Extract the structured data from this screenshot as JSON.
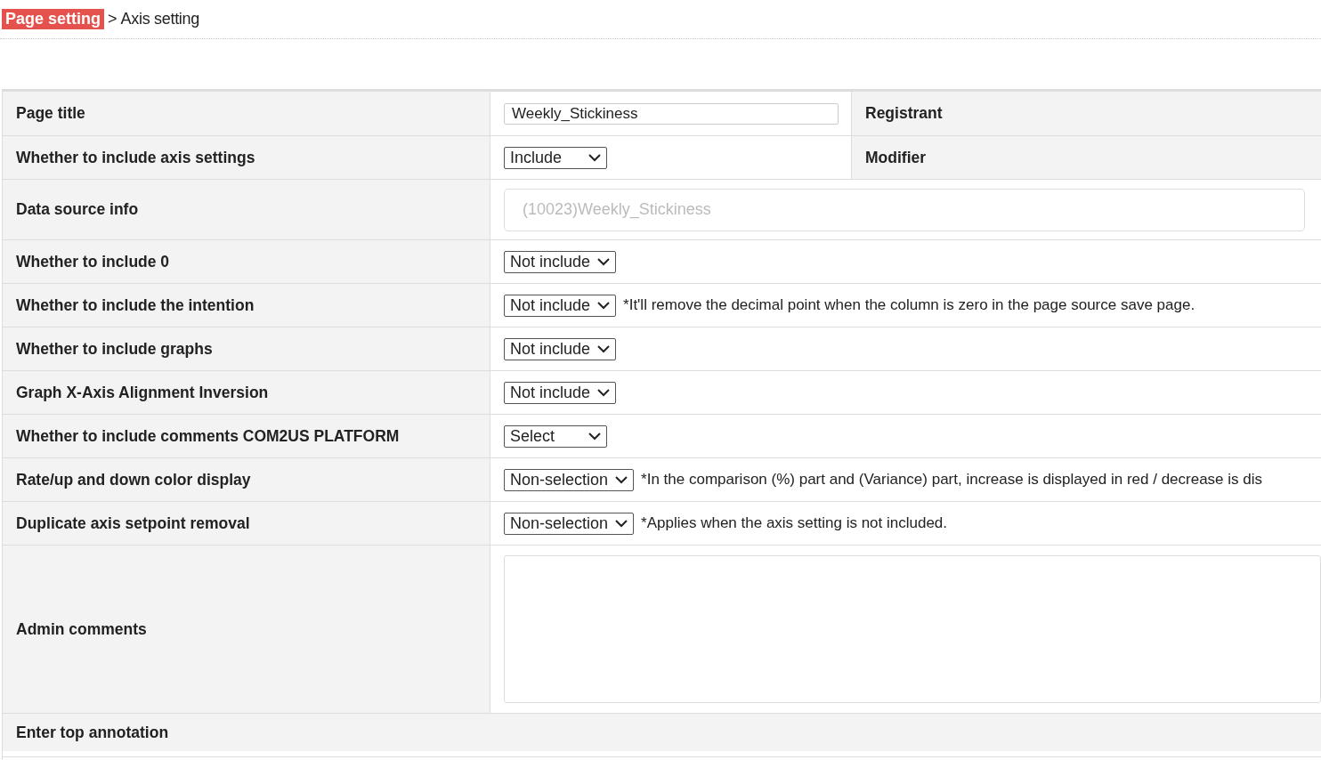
{
  "breadcrumb": {
    "parent": "Page setting",
    "separator": ">",
    "current": "Axis setting"
  },
  "rows": [
    {
      "label": "Page title",
      "kind": "text",
      "value": "Weekly_Stickiness",
      "side_label": "Registrant"
    },
    {
      "label": "Whether to include axis settings",
      "kind": "select",
      "value": "Include",
      "side_label": "Modifier"
    },
    {
      "label": "Data source info",
      "kind": "readonly",
      "value": "(10023)Weekly_Stickiness"
    },
    {
      "label": "Whether to include 0",
      "kind": "select",
      "value": "Not include"
    },
    {
      "label": "Whether to include the intention",
      "kind": "select",
      "value": "Not include",
      "note": "*It'll remove the decimal point when the column is zero in the page source save page."
    },
    {
      "label": "Whether to include graphs",
      "kind": "select",
      "value": "Not include"
    },
    {
      "label": "Graph X-Axis Alignment Inversion",
      "kind": "select",
      "value": "Not include"
    },
    {
      "label": "Whether to include comments COM2US PLATFORM",
      "kind": "select",
      "value": "Select"
    },
    {
      "label": "Rate/up and down color display",
      "kind": "select",
      "value": "Non-selection",
      "note": "*In the comparison (%) part and (Variance) part, increase is displayed in red / decrease is dis"
    },
    {
      "label": "Duplicate axis setpoint removal",
      "kind": "select",
      "value": "Non-selection",
      "note": "*Applies when the axis setting is not included."
    },
    {
      "label": "Admin comments",
      "kind": "textarea"
    },
    {
      "label": "Enter top annotation",
      "kind": "section"
    }
  ]
}
